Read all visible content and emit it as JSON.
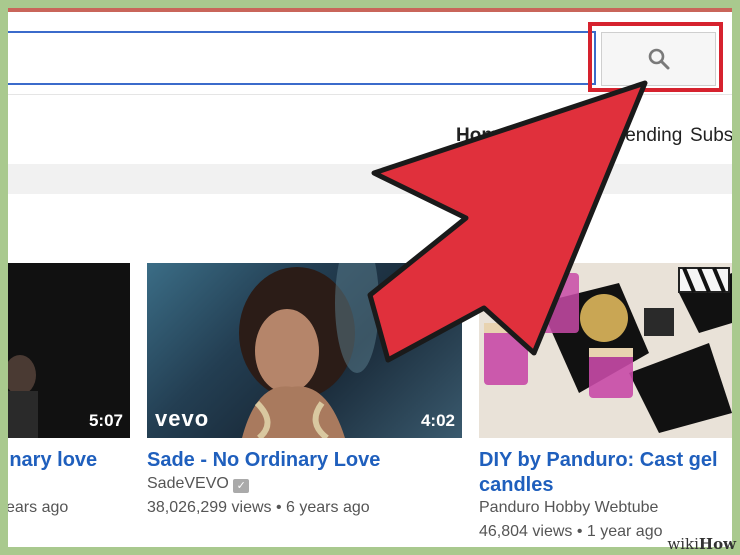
{
  "search": {
    "placeholder": ""
  },
  "nav": {
    "tabs": [
      "Home",
      "Trending",
      "Subscriptions"
    ]
  },
  "videos": [
    {
      "title": "No Ordinary love",
      "duration": "5:07",
      "age": "years ago"
    },
    {
      "title": "Sade - No Ordinary Love",
      "channel": "SadeVEVO",
      "views": "38,026,299 views",
      "age": "6 years ago",
      "duration": "4:02",
      "badge": "vevo"
    },
    {
      "title_line1": "DIY by Panduro: Cast gel",
      "title_line2": "candles",
      "channel": "Panduro Hobby Webtube",
      "views": "46,804 views",
      "age": "1 year ago"
    }
  ],
  "watermark": {
    "prefix": "wiki",
    "suffix": "How"
  },
  "colors": {
    "highlight": "#d6222e",
    "arrow": "#e0303c",
    "link": "#1f5fbd",
    "frame": "#a9c98e"
  },
  "icons": {
    "search": "magnifier",
    "verified": "check"
  }
}
